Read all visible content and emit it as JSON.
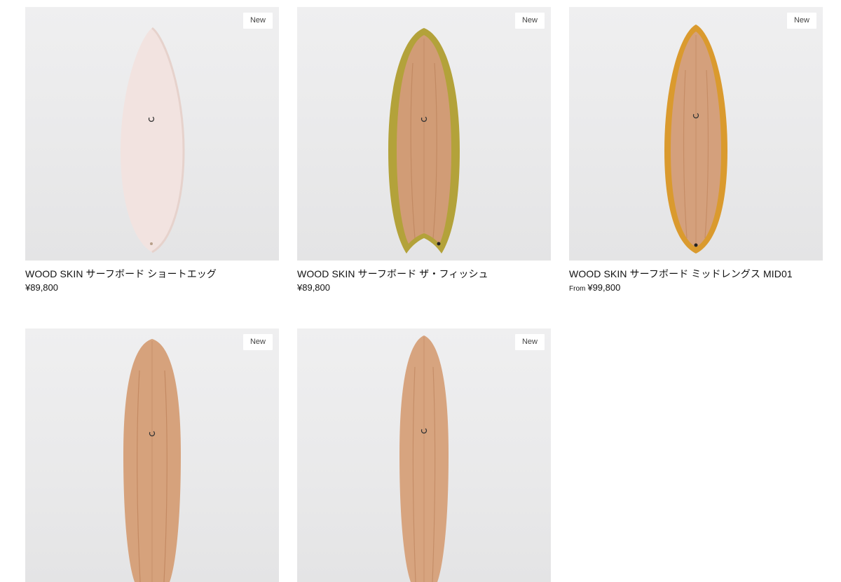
{
  "products": [
    {
      "badge": "New",
      "title": "WOOD SKIN サーフボード ショートエッグ",
      "price_prefix": "",
      "price": "¥89,800"
    },
    {
      "badge": "New",
      "title": "WOOD SKIN サーフボード ザ・フィッシュ",
      "price_prefix": "",
      "price": "¥89,800"
    },
    {
      "badge": "New",
      "title": "WOOD SKIN サーフボード ミッドレングス MID01",
      "price_prefix": "From",
      "price": "¥99,800"
    },
    {
      "badge": "New",
      "title": "",
      "price_prefix": "",
      "price": ""
    },
    {
      "badge": "New",
      "title": "",
      "price_prefix": "",
      "price": ""
    }
  ],
  "colors": {
    "image_bg": "#ebebec",
    "badge_bg": "#ffffff",
    "board_pink": "#f1e2df",
    "board_wood": "#d3a07a",
    "rail_olive": "#b5a238",
    "rail_amber": "#d9992f"
  }
}
